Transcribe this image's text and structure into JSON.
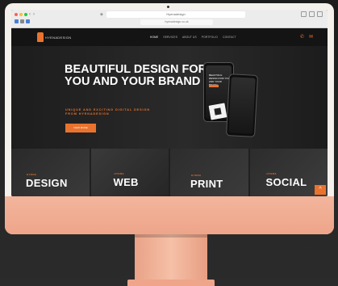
{
  "browser": {
    "tab_title": "Hyenadesign",
    "address": "hyenadesign.co.uk",
    "nav_back": "‹",
    "nav_forward": "›"
  },
  "site": {
    "logo_text": "HYENADESIGN",
    "nav": [
      "HOME",
      "SERVICES",
      "ABOUT US",
      "PORTFOLIO",
      "CONTACT"
    ],
    "phone_icon": "phone-icon",
    "mail_icon": "mail-icon",
    "accent": "#e9732e"
  },
  "hero": {
    "title": "BEAUTIFUL DESIGN FOR YOU AND YOUR BRAND",
    "subtitle": "UNIQUE AND EXCITING DIGITAL DESIGN FROM HYENADESIGN",
    "button": "VIEW MORE",
    "phone_text": "BEAUTIFUL DESIGN FOR YOU AND YOUR BRAND"
  },
  "tiles": [
    {
      "kicker": "HYENA",
      "title": "DESIGN"
    },
    {
      "kicker": "HYENA",
      "title": "WEB"
    },
    {
      "kicker": "HYENA",
      "title": "PRINT"
    },
    {
      "kicker": "HYENA",
      "title": "SOCIAL"
    }
  ],
  "scroll_button": "^"
}
